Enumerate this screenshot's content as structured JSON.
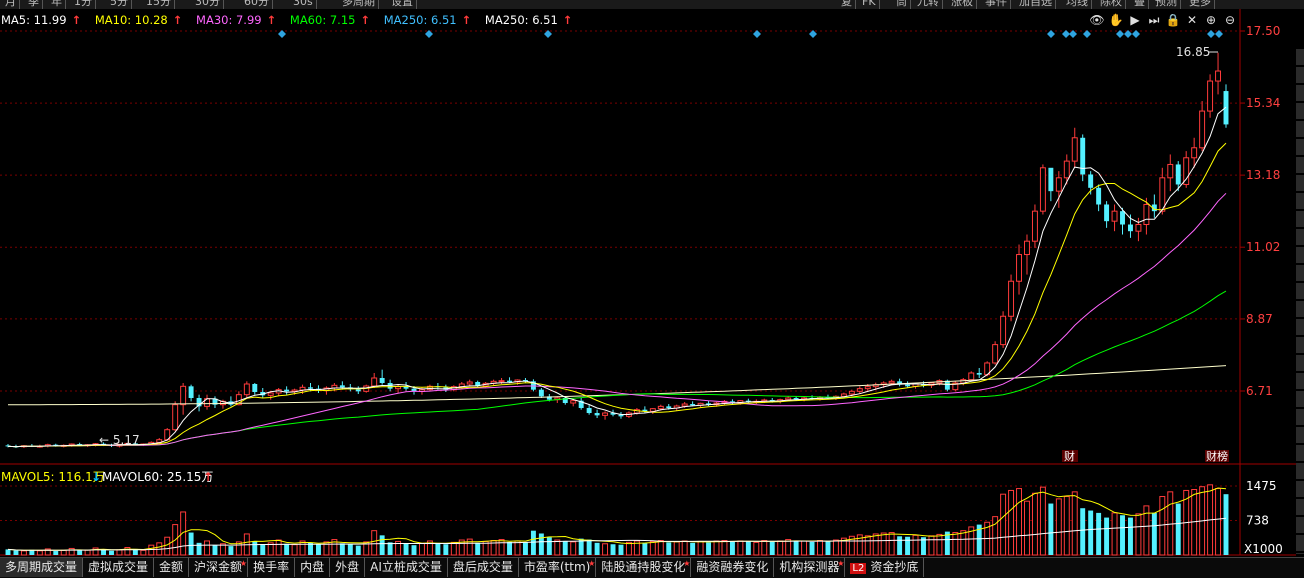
{
  "toolbar": {
    "items": [
      "月",
      "季",
      "年",
      "1分",
      "5分",
      "15分",
      "30分",
      "60分",
      "30s",
      "多周期",
      "设置"
    ],
    "right_items": [
      "复",
      "FK",
      "筒",
      "九转",
      "涨板",
      "事件",
      "加自选",
      "均线",
      "除权",
      "叠",
      "预测",
      "更多"
    ]
  },
  "legend": {
    "ma5": {
      "label": "MA5: 11.99",
      "arrow": "↑",
      "color": "#ffffff"
    },
    "ma10": {
      "label": "MA10: 10.28",
      "arrow": "↑",
      "color": "#ffff00"
    },
    "ma30": {
      "label": "MA30: 7.99",
      "arrow": "↑",
      "color": "#ff66ff"
    },
    "ma60": {
      "label": "MA60: 7.15",
      "arrow": "↑",
      "color": "#00ff00"
    },
    "ma250a": {
      "label": "MA250: 6.51",
      "arrow": "↑",
      "color": "#40c0ff"
    },
    "ma250b": {
      "label": "MA250: 6.51",
      "arrow": "↑",
      "color": "#ffffff"
    }
  },
  "tool_icons": [
    "eye-icon",
    "hand-icon",
    "play-icon",
    "skip-icon",
    "lock-icon",
    "close-icon",
    "zoom-in-icon",
    "zoom-out-icon"
  ],
  "tool_glyphs": [
    "👁",
    "✋",
    "▶",
    "⏭",
    "🔒",
    "✕",
    "⊕",
    "⊖"
  ],
  "price_axis": {
    "labels": [
      "17.50",
      "15.34",
      "13.18",
      "11.02",
      "8.87",
      "6.71"
    ],
    "values": [
      17.5,
      15.34,
      13.18,
      11.02,
      8.87,
      6.71
    ]
  },
  "annotations": {
    "high": "16.85",
    "low": "5.17",
    "fin_marker": "财",
    "fin_marker2": "财榜"
  },
  "volume": {
    "legend_mavol5": "MAVOL5: 116.1万",
    "legend_mavol5_arrow": "↓",
    "legend_mavol60": "MAVOL60: 25.15万",
    "legend_mavol60_arrow": "↑",
    "axis_labels": [
      "1475",
      "738"
    ],
    "axis_values": [
      1475,
      738
    ],
    "unit": "X1000"
  },
  "tabs": [
    {
      "label": "多周期成交量",
      "star": false,
      "active": true
    },
    {
      "label": "虚拟成交量",
      "star": false
    },
    {
      "label": "金额",
      "star": false
    },
    {
      "label": "沪深金额",
      "star": true
    },
    {
      "label": "换手率",
      "star": false
    },
    {
      "label": "内盘",
      "star": false
    },
    {
      "label": "外盘",
      "star": false
    },
    {
      "label": "AI立桩成交量",
      "star": false
    },
    {
      "label": "盘后成交量",
      "star": false
    },
    {
      "label": "市盈率(ttm)",
      "star": true
    },
    {
      "label": "陆股通持股变化",
      "star": true
    },
    {
      "label": "融资融券变化",
      "star": false
    },
    {
      "label": "机构探测器",
      "star": true
    },
    {
      "label": "资金抄底",
      "star": false,
      "l2": "L2"
    }
  ],
  "colors": {
    "up": "#ff3b3b",
    "down": "#54f0ff",
    "grid": "#7a0000",
    "axis": "#a00000",
    "ma5": "#ffffff",
    "ma10": "#ffff00",
    "ma30": "#ff66ff",
    "ma60": "#00ff00",
    "ma250": "#ffffcc"
  },
  "chart_data": {
    "type": "candlestick",
    "candles": [
      [
        5.08,
        5.12,
        5.02,
        5.05
      ],
      [
        5.05,
        5.1,
        5.0,
        5.04
      ],
      [
        5.04,
        5.09,
        5.0,
        5.07
      ],
      [
        5.07,
        5.12,
        5.03,
        5.05
      ],
      [
        5.05,
        5.1,
        5.01,
        5.06
      ],
      [
        5.06,
        5.13,
        5.02,
        5.1
      ],
      [
        5.1,
        5.13,
        5.04,
        5.06
      ],
      [
        5.06,
        5.11,
        5.02,
        5.08
      ],
      [
        5.08,
        5.14,
        5.04,
        5.12
      ],
      [
        5.12,
        5.16,
        5.06,
        5.08
      ],
      [
        5.08,
        5.12,
        5.03,
        5.1
      ],
      [
        5.1,
        5.15,
        5.05,
        5.13
      ],
      [
        5.13,
        5.17,
        5.06,
        5.09
      ],
      [
        5.09,
        5.13,
        5.03,
        5.06
      ],
      [
        5.06,
        5.12,
        5.02,
        5.11
      ],
      [
        5.11,
        5.16,
        5.07,
        5.14
      ],
      [
        5.14,
        5.18,
        5.08,
        5.1
      ],
      [
        5.1,
        5.14,
        5.06,
        5.12
      ],
      [
        5.12,
        5.2,
        5.08,
        5.17
      ],
      [
        5.17,
        5.3,
        5.12,
        5.25
      ],
      [
        5.25,
        5.6,
        5.22,
        5.55
      ],
      [
        5.55,
        6.4,
        5.5,
        6.3
      ],
      [
        6.3,
        6.95,
        6.0,
        6.85
      ],
      [
        6.85,
        6.9,
        6.4,
        6.5
      ],
      [
        6.5,
        6.6,
        6.1,
        6.25
      ],
      [
        6.25,
        6.6,
        6.15,
        6.48
      ],
      [
        6.48,
        6.55,
        6.2,
        6.3
      ],
      [
        6.3,
        6.45,
        6.18,
        6.4
      ],
      [
        6.4,
        6.55,
        6.25,
        6.3
      ],
      [
        6.3,
        6.7,
        6.28,
        6.6
      ],
      [
        6.6,
        7.0,
        6.5,
        6.92
      ],
      [
        6.92,
        6.95,
        6.6,
        6.68
      ],
      [
        6.68,
        6.8,
        6.5,
        6.58
      ],
      [
        6.58,
        6.7,
        6.45,
        6.65
      ],
      [
        6.65,
        6.8,
        6.55,
        6.75
      ],
      [
        6.75,
        6.85,
        6.6,
        6.7
      ],
      [
        6.7,
        6.78,
        6.6,
        6.74
      ],
      [
        6.74,
        6.9,
        6.62,
        6.82
      ],
      [
        6.82,
        6.95,
        6.7,
        6.78
      ],
      [
        6.78,
        6.88,
        6.65,
        6.72
      ],
      [
        6.72,
        6.85,
        6.6,
        6.8
      ],
      [
        6.8,
        6.95,
        6.7,
        6.88
      ],
      [
        6.88,
        7.0,
        6.75,
        6.82
      ],
      [
        6.82,
        6.92,
        6.7,
        6.76
      ],
      [
        6.76,
        6.85,
        6.62,
        6.7
      ],
      [
        6.7,
        6.9,
        6.66,
        6.86
      ],
      [
        6.86,
        7.25,
        6.8,
        7.1
      ],
      [
        7.1,
        7.35,
        6.9,
        6.95
      ],
      [
        6.95,
        7.05,
        6.7,
        6.78
      ],
      [
        6.78,
        6.9,
        6.65,
        6.84
      ],
      [
        6.84,
        6.98,
        6.72,
        6.78
      ],
      [
        6.78,
        6.86,
        6.6,
        6.7
      ],
      [
        6.7,
        6.82,
        6.6,
        6.75
      ],
      [
        6.75,
        6.9,
        6.7,
        6.85
      ],
      [
        6.85,
        6.95,
        6.75,
        6.82
      ],
      [
        6.82,
        6.9,
        6.68,
        6.75
      ],
      [
        6.75,
        6.88,
        6.7,
        6.84
      ],
      [
        6.84,
        6.98,
        6.78,
        6.92
      ],
      [
        6.92,
        7.05,
        6.85,
        6.98
      ],
      [
        6.98,
        7.02,
        6.8,
        6.86
      ],
      [
        6.86,
        6.98,
        6.82,
        6.94
      ],
      [
        6.94,
        7.05,
        6.88,
        7.0
      ],
      [
        7.0,
        7.1,
        6.92,
        7.02
      ],
      [
        7.02,
        7.12,
        6.95,
        6.98
      ],
      [
        6.98,
        7.06,
        6.9,
        7.04
      ],
      [
        7.04,
        7.1,
        6.96,
        7.0
      ],
      [
        7.0,
        7.06,
        6.7,
        6.75
      ],
      [
        6.75,
        6.8,
        6.5,
        6.55
      ],
      [
        6.55,
        6.62,
        6.4,
        6.45
      ],
      [
        6.45,
        6.55,
        6.35,
        6.5
      ],
      [
        6.5,
        6.56,
        6.3,
        6.35
      ],
      [
        6.35,
        6.48,
        6.25,
        6.42
      ],
      [
        6.42,
        6.5,
        6.15,
        6.2
      ],
      [
        6.2,
        6.3,
        6.0,
        6.05
      ],
      [
        6.05,
        6.15,
        5.9,
        5.98
      ],
      [
        5.98,
        6.1,
        5.85,
        6.05
      ],
      [
        6.05,
        6.15,
        5.95,
        6.0
      ],
      [
        6.0,
        6.08,
        5.88,
        5.95
      ],
      [
        5.95,
        6.1,
        5.9,
        6.05
      ],
      [
        6.05,
        6.2,
        6.0,
        6.15
      ],
      [
        6.15,
        6.25,
        6.05,
        6.1
      ],
      [
        6.1,
        6.2,
        6.02,
        6.18
      ],
      [
        6.18,
        6.3,
        6.12,
        6.25
      ],
      [
        6.25,
        6.32,
        6.15,
        6.2
      ],
      [
        6.2,
        6.3,
        6.12,
        6.26
      ],
      [
        6.26,
        6.38,
        6.2,
        6.32
      ],
      [
        6.32,
        6.4,
        6.25,
        6.28
      ],
      [
        6.28,
        6.36,
        6.22,
        6.34
      ],
      [
        6.34,
        6.42,
        6.26,
        6.3
      ],
      [
        6.3,
        6.38,
        6.24,
        6.35
      ],
      [
        6.35,
        6.44,
        6.3,
        6.4
      ],
      [
        6.4,
        6.46,
        6.32,
        6.36
      ],
      [
        6.36,
        6.44,
        6.3,
        6.42
      ],
      [
        6.42,
        6.48,
        6.34,
        6.38
      ],
      [
        6.38,
        6.46,
        6.32,
        6.4
      ],
      [
        6.4,
        6.48,
        6.35,
        6.44
      ],
      [
        6.44,
        6.5,
        6.36,
        6.4
      ],
      [
        6.4,
        6.48,
        6.34,
        6.45
      ],
      [
        6.45,
        6.55,
        6.4,
        6.5
      ],
      [
        6.5,
        6.56,
        6.42,
        6.46
      ],
      [
        6.46,
        6.54,
        6.4,
        6.5
      ],
      [
        6.5,
        6.58,
        6.44,
        6.48
      ],
      [
        6.48,
        6.56,
        6.42,
        6.52
      ],
      [
        6.52,
        6.6,
        6.46,
        6.5
      ],
      [
        6.5,
        6.58,
        6.44,
        6.55
      ],
      [
        6.55,
        6.66,
        6.5,
        6.62
      ],
      [
        6.62,
        6.75,
        6.55,
        6.7
      ],
      [
        6.7,
        6.85,
        6.62,
        6.78
      ],
      [
        6.78,
        6.92,
        6.7,
        6.84
      ],
      [
        6.84,
        6.96,
        6.74,
        6.9
      ],
      [
        6.9,
        7.0,
        6.8,
        6.95
      ],
      [
        6.95,
        7.05,
        6.88,
        7.0
      ],
      [
        7.0,
        7.08,
        6.85,
        6.9
      ],
      [
        6.9,
        7.0,
        6.8,
        6.85
      ],
      [
        6.85,
        6.95,
        6.78,
        6.92
      ],
      [
        6.92,
        7.0,
        6.82,
        6.88
      ],
      [
        6.88,
        6.98,
        6.8,
        6.95
      ],
      [
        6.95,
        7.06,
        6.88,
        7.02
      ],
      [
        7.02,
        7.05,
        6.7,
        6.75
      ],
      [
        6.75,
        7.0,
        6.7,
        6.95
      ],
      [
        6.95,
        7.1,
        6.88,
        7.05
      ],
      [
        7.05,
        7.3,
        7.0,
        7.25
      ],
      [
        7.25,
        7.4,
        7.1,
        7.2
      ],
      [
        7.2,
        7.6,
        7.15,
        7.55
      ],
      [
        7.55,
        8.2,
        7.5,
        8.1
      ],
      [
        8.1,
        9.1,
        8.0,
        8.95
      ],
      [
        8.95,
        10.2,
        8.8,
        10.0
      ],
      [
        10.0,
        11.1,
        9.6,
        10.8
      ],
      [
        10.8,
        11.4,
        10.2,
        11.2
      ],
      [
        11.2,
        12.3,
        11.0,
        12.1
      ],
      [
        12.1,
        13.5,
        12.0,
        13.4
      ],
      [
        13.4,
        13.2,
        12.4,
        12.7
      ],
      [
        12.7,
        13.3,
        12.2,
        13.1
      ],
      [
        13.1,
        13.8,
        12.9,
        13.6
      ],
      [
        13.6,
        14.6,
        13.4,
        14.3
      ],
      [
        14.3,
        14.4,
        13.0,
        13.2
      ],
      [
        13.2,
        13.3,
        12.6,
        12.8
      ],
      [
        12.8,
        12.9,
        12.1,
        12.3
      ],
      [
        12.3,
        12.4,
        11.6,
        11.8
      ],
      [
        11.8,
        12.3,
        11.5,
        12.1
      ],
      [
        12.1,
        12.2,
        11.4,
        11.7
      ],
      [
        11.7,
        12.0,
        11.3,
        11.5
      ],
      [
        11.5,
        11.9,
        11.2,
        11.7
      ],
      [
        11.7,
        12.5,
        11.4,
        12.3
      ],
      [
        12.3,
        12.6,
        11.9,
        12.1
      ],
      [
        12.1,
        13.4,
        12.0,
        13.1
      ],
      [
        13.1,
        13.8,
        12.7,
        13.5
      ],
      [
        13.5,
        13.6,
        12.7,
        12.9
      ],
      [
        12.9,
        13.9,
        12.8,
        13.7
      ],
      [
        13.7,
        14.3,
        13.4,
        14.0
      ],
      [
        14.0,
        15.4,
        13.9,
        15.1
      ],
      [
        15.1,
        16.2,
        14.9,
        16.0
      ],
      [
        16.0,
        16.85,
        15.6,
        16.3
      ],
      [
        15.7,
        15.9,
        14.6,
        14.7
      ]
    ],
    "volume": [
      120,
      95,
      88,
      110,
      90,
      130,
      85,
      100,
      140,
      95,
      105,
      150,
      120,
      90,
      110,
      160,
      130,
      100,
      210,
      260,
      380,
      650,
      920,
      480,
      260,
      300,
      210,
      240,
      190,
      280,
      450,
      300,
      230,
      260,
      320,
      240,
      220,
      300,
      260,
      230,
      280,
      330,
      250,
      230,
      200,
      280,
      520,
      420,
      270,
      290,
      240,
      210,
      250,
      300,
      260,
      230,
      270,
      320,
      340,
      260,
      290,
      310,
      330,
      280,
      300,
      270,
      520,
      460,
      380,
      320,
      300,
      280,
      350,
      330,
      260,
      240,
      230,
      220,
      270,
      300,
      260,
      290,
      310,
      270,
      280,
      300,
      260,
      290,
      270,
      300,
      310,
      280,
      300,
      290,
      270,
      310,
      280,
      300,
      330,
      290,
      300,
      280,
      310,
      290,
      320,
      360,
      400,
      430,
      410,
      450,
      470,
      480,
      400,
      390,
      420,
      380,
      410,
      440,
      500,
      480,
      520,
      600,
      650,
      700,
      820,
      1300,
      1380,
      1420,
      1150,
      1320,
      1450,
      1100,
      1200,
      1250,
      1350,
      1000,
      950,
      900,
      800,
      900,
      850,
      800,
      880,
      1050,
      900,
      1250,
      1350,
      1100,
      1380,
      1400,
      1460,
      1500,
      1420,
      1300
    ]
  }
}
